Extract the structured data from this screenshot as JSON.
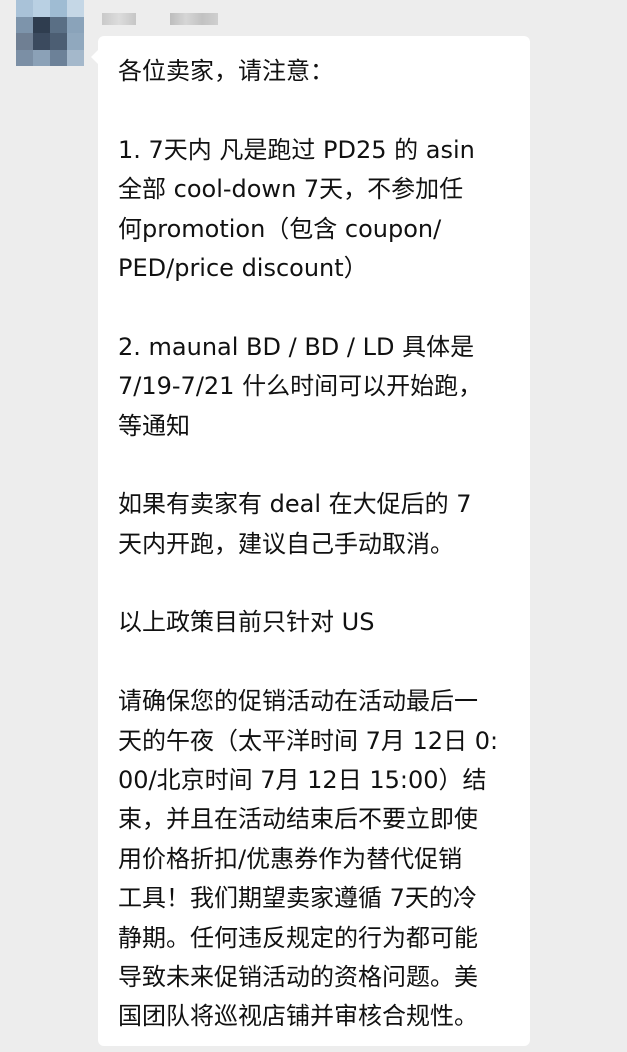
{
  "sender": {
    "name_part_1": "",
    "name_part_2": ""
  },
  "avatar": {
    "pixel_colors": [
      "#a9c2d8",
      "#b9d0e3",
      "#9fbcd3",
      "#c5d7e6",
      "#7d94ab",
      "#2f3d4f",
      "#5a6f85",
      "#8aa3ba",
      "#6f7f93",
      "#3b4a5e",
      "#4c5e73",
      "#90a8be",
      "#7b8fa5",
      "#8ba1b7",
      "#6c8198",
      "#a4b8cb"
    ]
  },
  "message": {
    "lines": [
      "各位卖家，请注意：",
      "",
      "1. 7天内 凡是跑过 PD25 的 asin",
      "全部 cool-down 7天，不参加任",
      "何promotion（包含 coupon/",
      "PED/price discount）",
      "",
      "2. maunal BD / BD / LD 具体是",
      "7/19-7/21 什么时间可以开始跑，",
      "等通知",
      "",
      "如果有卖家有 deal 在大促后的 7",
      "天内开跑，建议自己手动取消。",
      "",
      "以上政策目前只针对 US",
      "",
      "请确保您的促销活动在活动最后一",
      "天的午夜（太平洋时间 7月 12日 0:",
      "00/北京时间 7月 12日 15:00）结",
      "束，并且在活动结束后不要立即使",
      "用价格折扣/优惠券作为替代促销",
      "工具！我们期望卖家遵循 7天的冷",
      "静期。任何违反规定的行为都可能",
      "导致未来促销活动的资格问题。美",
      "国团队将巡视店铺并审核合规性。"
    ]
  }
}
